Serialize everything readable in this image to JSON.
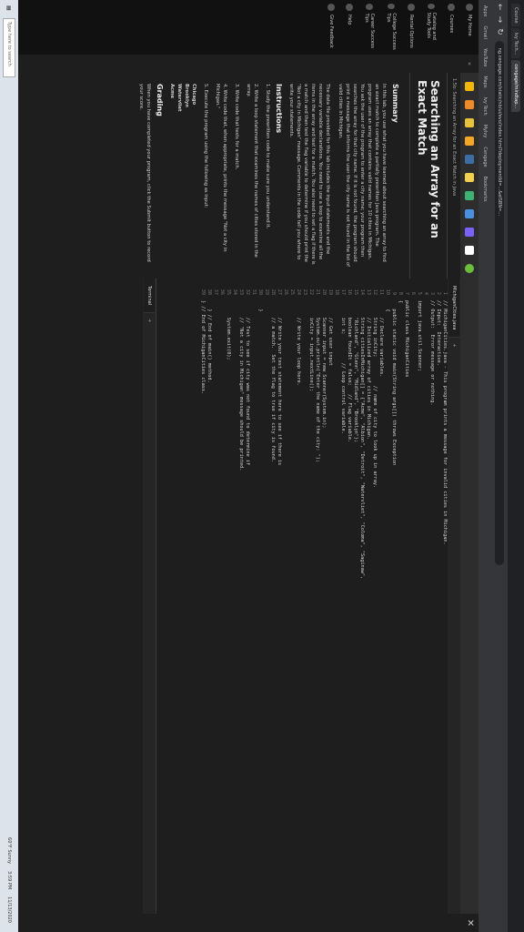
{
  "browser": {
    "tabs": [
      "Course",
      "Ivy Tech...",
      "cengage/mindtap..."
    ],
    "url": "ng.cengage.com/static/nb/ui/evo/index.html?deploymentId=...&eISBN=..."
  },
  "bookmarks": [
    "Apps",
    "Gmail",
    "YouTube",
    "Maps",
    "Ivy Tech",
    "MyIvy",
    "Cengage",
    "Bookmarks"
  ],
  "sidebar": {
    "items": [
      {
        "icon": "home-icon",
        "label": "My Home"
      },
      {
        "icon": "book-icon",
        "label": "Courses"
      },
      {
        "icon": "catalog-icon",
        "label": "Catalog and Study Tools"
      },
      {
        "icon": "rental-icon",
        "label": "Rental Options"
      },
      {
        "icon": "tips-icon",
        "label": "College Success Tips"
      },
      {
        "icon": "career-icon",
        "label": "Career Success Tips"
      },
      {
        "icon": "help-icon",
        "label": "Help"
      },
      {
        "icon": "feedback-icon",
        "label": "Give Feedback"
      }
    ]
  },
  "lesson": {
    "breadcrumb": "1.5b: Searching an Array for an Exact Match in Java",
    "title": "Searching an Array for an Exact Match",
    "summary_heading": "Summary",
    "summary_p1": "In this lab, you use what you have learned about searching an array to find an exact match to complete a partially prewritten Java program. The program uses an array that contains valid names for 10 cities in Michigan. You ask the user of the program to enter a city name; your program then searches the array for that city name. If it is not found, the program should print a message that informs the user the city name is not found in the list of valid cities in Michigan.",
    "summary_p2": "The data file provided for this lab includes the input statements and the necessary variable declarations. You need to use a loop to examine all the items in the array and test for a match. You also need to set a flag if there is a match and then test the flag variable to determine if you should print the \"Not a city in Michigan\" message. Comments in the code tell you where to write your statements.",
    "instructions_heading": "Instructions",
    "steps": [
      "1. Study the prewritten code to make sure you understand it.",
      "2. Write a loop statement that examines the names of cities stored in the array.",
      "3. Write code that tests for a match.",
      "4. Write code that, when appropriate, prints the message \"Not a city in Michigan.\"",
      "5. Execute the program using the following as input:"
    ],
    "inputs": [
      "Chicago",
      "Brooklyn",
      "Watervliet",
      "Acme"
    ],
    "grading_heading": "Grading",
    "grading_text": "When you have completed your program, click the Submit button to record your score."
  },
  "editor": {
    "file_tab": "MichiganCities.java",
    "terminal_tab": "Terminal",
    "lines": [
      "// MichiganCities.java - This program prints a message for invalid cities in Michigan.",
      "// Input:  Interactive.",
      "// Output:  Error message or nothing.",
      "",
      "import java.util.Scanner;",
      "",
      "public class MichiganCities",
      "{",
      "   public static void main(String args[]) throws Exception",
      "   {",
      "      // Declare variables.",
      "      String inCity;          // name of city to look up in array.",
      "      // Initialized array of cities in Michigan.",
      "      String citiesInMichigan[] = {\"Acme\", \"Albion\", \"Detroit\", \"Watervliet\", \"Coloma\", \"Saginaw\",",
      "      \"Richland\", \"Glenn\", \"Midland\", \"Brooklyn\"};",
      "      boolean foundIt = false;   // Flag variable.",
      "      int x;          // Loop control variable.",
      "",
      "      // Get user input",
      "      Scanner input = new Scanner(System.in);",
      "      System.out.println(\"Enter the name of the city: \");",
      "      inCity = input.nextLine();",
      "",
      "      // Write your loop here.",
      "",
      "",
      "      // Write your test statement here to see if there is",
      "      // a match.  Set the flag to true if city is found.",
      "",
      "   }",
      "",
      "      // Test to see if city was not found to determine if",
      "      // \"Not a city in Michigan\" message should be printed.",
      "",
      "      System.exit(0);",
      "",
      "",
      "   } // End of main() method.",
      "} // End of MichiganCities class."
    ]
  },
  "taskbar": {
    "search_placeholder": "Type here to search",
    "clock": "3:59 PM",
    "date": "11/13/2020",
    "weather": "60°F Sunny"
  }
}
